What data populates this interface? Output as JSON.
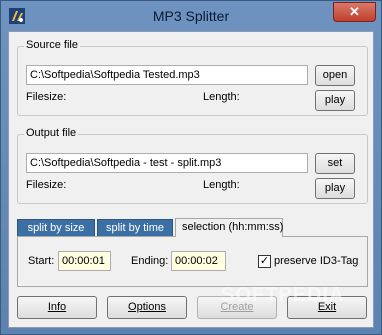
{
  "window": {
    "title": "MP3 Splitter",
    "close_glyph": "✕",
    "app_icon": "app-logo-icon"
  },
  "source": {
    "legend": "Source file",
    "path": "C:\\Softpedia\\Softpedia Tested.mp3",
    "open_label": "open",
    "filesize_label": "Filesize:",
    "length_label": "Length:",
    "play_label": "play"
  },
  "output": {
    "legend": "Output file",
    "path": "C:\\Softpedia\\Softpedia - test - split.mp3",
    "set_label": "set",
    "filesize_label": "Filesize:",
    "length_label": "Length:",
    "play_label": "play"
  },
  "tabs": [
    {
      "label": "split by size",
      "active": false
    },
    {
      "label": "split by time",
      "active": false
    },
    {
      "label": "selection (hh:mm:ss)",
      "active": true
    }
  ],
  "selection": {
    "start_label": "Start:",
    "start_value": "00:00:01",
    "ending_label": "Ending:",
    "ending_value": "00:00:02",
    "preserve_label": "preserve ID3-Tag",
    "preserve_checked": true
  },
  "buttons": {
    "info": "Info",
    "options": "Options",
    "create": "Create",
    "exit": "Exit"
  },
  "watermark": "SOFTPEDIA"
}
